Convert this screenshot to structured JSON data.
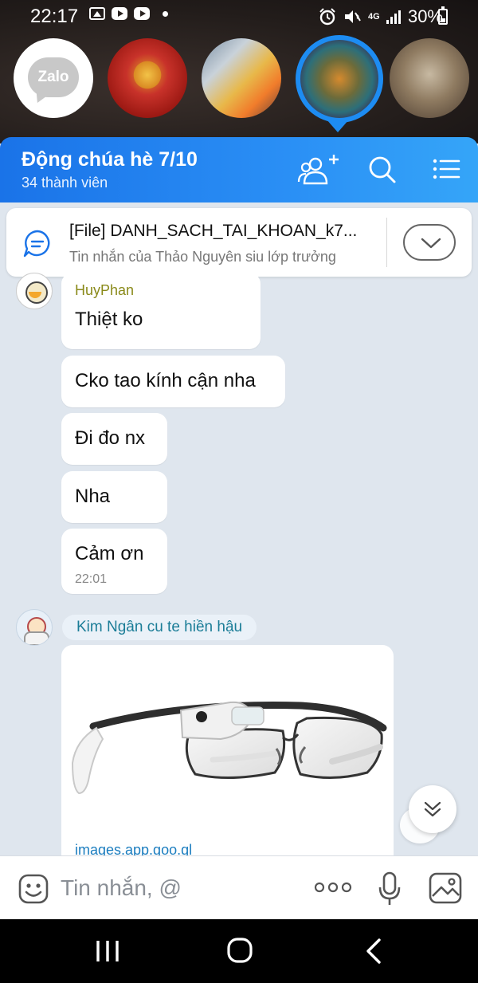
{
  "status_bar": {
    "time": "22:17",
    "network": "4G",
    "battery": "30%"
  },
  "chat_heads": [
    {
      "name": "zalo-bubble",
      "label": "Zalo"
    },
    {
      "name": "chat-head-1"
    },
    {
      "name": "chat-head-2"
    },
    {
      "name": "chat-head-3",
      "active": true
    },
    {
      "name": "chat-head-4"
    }
  ],
  "header": {
    "title": "Động chúa hè 7/10",
    "subtitle": "34 thành viên"
  },
  "pinned": {
    "title": "[File] DANH_SACH_TAI_KHOAN_k7...",
    "subtitle": "Tin nhắn của Thảo Nguyên siu lớp trưởng"
  },
  "messages": [
    {
      "sender": "HuyPhan",
      "text": "Thiệt ko"
    },
    {
      "text": "Cko tao kính cận nha"
    },
    {
      "text": "Đi đo nx"
    },
    {
      "text": "Nha"
    },
    {
      "text": "Cảm ơn",
      "time": "22:01"
    }
  ],
  "link_message": {
    "sender": "Kim Ngân cu te hiền hậu",
    "domain": "images.app.goo.gl"
  },
  "composer": {
    "placeholder": "Tin nhắn, @"
  },
  "colors": {
    "header_start": "#1a73e8",
    "header_end": "#35a5f8",
    "active_ring": "#1d8cf2",
    "chat_background": "#dfe6ee",
    "sender_huy": "#8a8a1a",
    "sender_kim": "#1b7d97"
  },
  "icons": {
    "add_member": "add-member-icon",
    "search": "search-icon",
    "menu": "menu-icon",
    "pinned": "chat-bubble-icon",
    "expand": "chevron-down-icon",
    "scroll_down": "double-chevron-down-icon",
    "emoji": "emoji-icon",
    "more": "more-dots-icon",
    "mic": "microphone-icon",
    "image": "image-icon",
    "nav_recent": "recent-apps-icon",
    "nav_home": "home-icon",
    "nav_back": "back-icon"
  }
}
